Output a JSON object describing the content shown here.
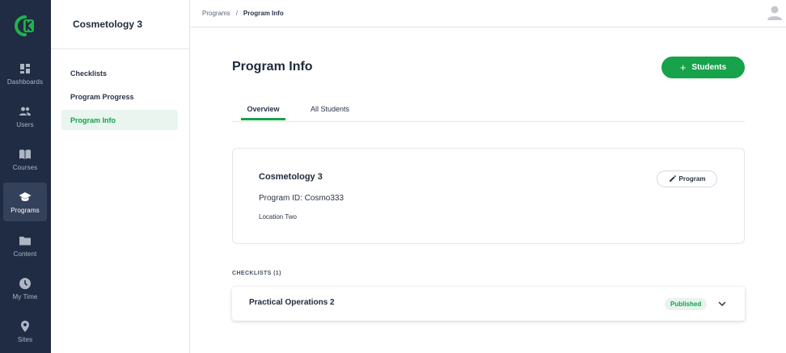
{
  "rail": {
    "items": [
      {
        "label": "Dashboards",
        "icon": "dashboard-icon"
      },
      {
        "label": "Users",
        "icon": "users-icon"
      },
      {
        "label": "Courses",
        "icon": "book-icon"
      },
      {
        "label": "Programs",
        "icon": "graduation-cap-icon",
        "active": true
      },
      {
        "label": "Content",
        "icon": "folder-icon"
      },
      {
        "label": "My Time",
        "icon": "clock-icon"
      },
      {
        "label": "Sites",
        "icon": "location-pin-icon"
      }
    ]
  },
  "sidebar": {
    "title": "Cosmetology 3",
    "items": [
      {
        "label": "Checklists"
      },
      {
        "label": "Program Progress"
      },
      {
        "label": "Program Info",
        "active": true
      }
    ]
  },
  "breadcrumb": {
    "parent": "Programs",
    "separator": "/",
    "current": "Program Info"
  },
  "page": {
    "title": "Program Info",
    "add_button": "Students"
  },
  "tabs": [
    {
      "label": "Overview",
      "active": true
    },
    {
      "label": "All Students"
    }
  ],
  "program": {
    "name": "Cosmetology 3",
    "id_text": "Program ID: Cosmo333",
    "location": "Location Two",
    "edit_button": "Program"
  },
  "checklists": {
    "heading": "CHECKLISTS (1)",
    "items": [
      {
        "title": "Practical Operations 2",
        "status": "Published"
      }
    ]
  },
  "colors": {
    "rail_bg": "#1f2c43",
    "accent": "#17a24b",
    "active_bg": "#e9f5ee"
  }
}
